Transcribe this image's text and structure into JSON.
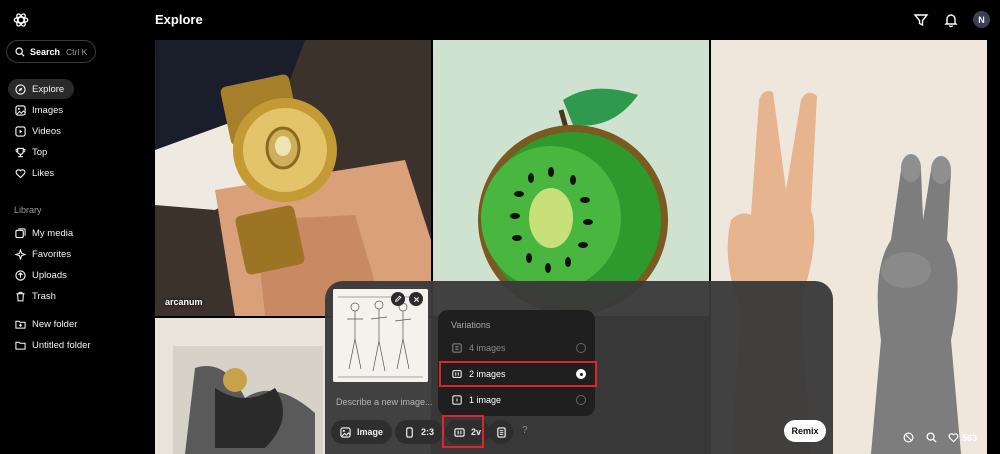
{
  "header": {
    "title": "Explore"
  },
  "search": {
    "label": "Search",
    "shortcut": "Ctrl K"
  },
  "nav": [
    {
      "label": "Explore",
      "icon": "compass-icon",
      "active": true
    },
    {
      "label": "Images",
      "icon": "image-icon"
    },
    {
      "label": "Videos",
      "icon": "video-icon"
    },
    {
      "label": "Top",
      "icon": "trophy-icon"
    },
    {
      "label": "Likes",
      "icon": "heart-icon"
    }
  ],
  "library": {
    "label": "Library",
    "items": [
      {
        "label": "My media",
        "icon": "media-icon"
      },
      {
        "label": "Favorites",
        "icon": "sparkle-icon"
      },
      {
        "label": "Uploads",
        "icon": "upload-icon"
      },
      {
        "label": "Trash",
        "icon": "trash-icon"
      }
    ],
    "folders": [
      {
        "label": "New folder",
        "icon": "folder-plus-icon"
      },
      {
        "label": "Untitled folder",
        "icon": "folder-icon"
      }
    ]
  },
  "user": {
    "initial": "N"
  },
  "tiles": {
    "first_caption": "arcanum"
  },
  "composer": {
    "placeholder": "Describe a new image...",
    "chips": {
      "type": "Image",
      "aspect": "2:3",
      "variations": "2v"
    },
    "remix_label": "Remix",
    "help": "?"
  },
  "variations_popover": {
    "title": "Variations",
    "options": [
      {
        "label": "4 images",
        "selected": false
      },
      {
        "label": "2 images",
        "selected": true
      },
      {
        "label": "1 image",
        "selected": false
      }
    ]
  },
  "stats": {
    "likes": "563"
  },
  "colors": {
    "highlight": "#e0242c",
    "panel": "#3a3a3a",
    "popover": "#1f1f1f"
  }
}
